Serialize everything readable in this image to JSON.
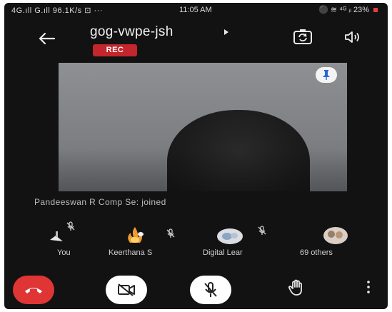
{
  "status_bar": {
    "left": "4G.ıll G.ıll 96.1K/s ⊡ ···",
    "time": "11:05 AM",
    "right": "⚫ ≋ ⁴ᴳ ᵢₗ 23%"
  },
  "header": {
    "meeting_code": "gog-vwpe-jsh",
    "rec_label": "REC"
  },
  "colors": {
    "rec": "#c3262c",
    "end_call": "#e03535",
    "background": "#121212"
  },
  "main": {
    "joined_message": "Pandeeswan  R Comp  Se: joined"
  },
  "participants": [
    {
      "name": "You",
      "icon": "monitor-avatar"
    },
    {
      "name": "Keerthana S",
      "icon": "fire-avatar"
    },
    {
      "name": "Digital Lear",
      "icon": "photo-avatar"
    },
    {
      "name": "69 others",
      "icon": "group-avatar"
    }
  ],
  "controls": {
    "end_call": "end-call-icon",
    "camera": "camera-off-icon",
    "mic": "mic-off-icon",
    "raise_hand": "raise-hand-icon",
    "more": "more-vertical-icon"
  }
}
